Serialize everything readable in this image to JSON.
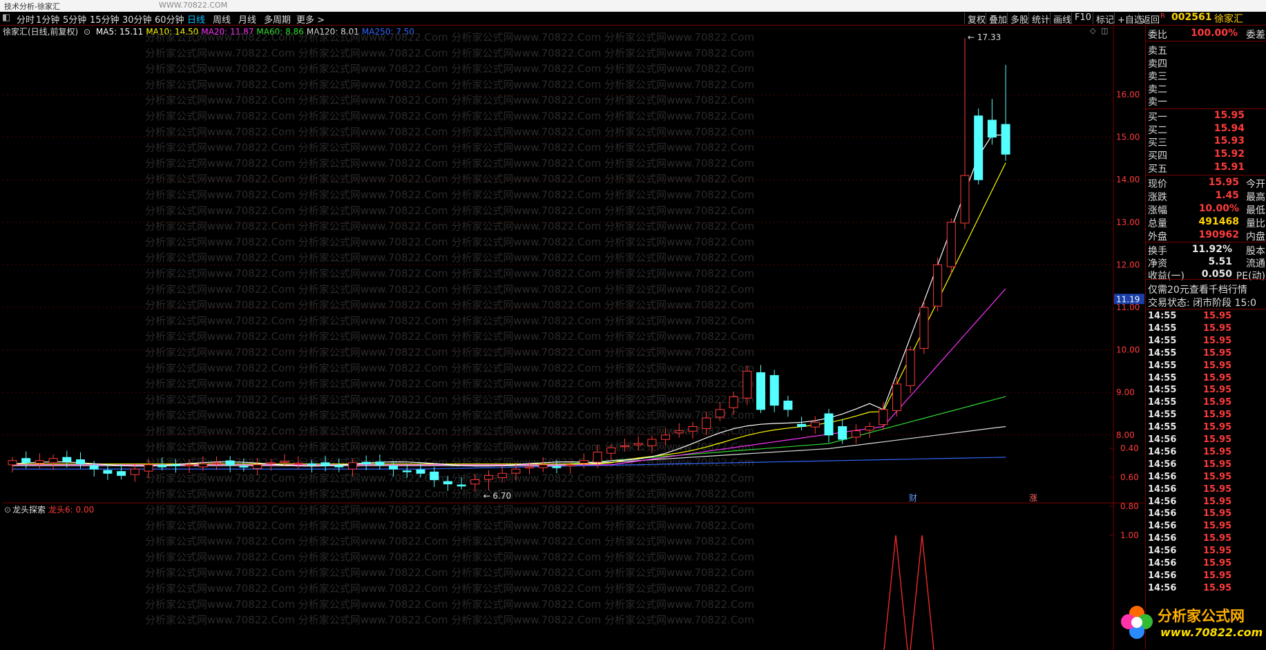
{
  "topbar": {
    "title": "技术分析-徐家汇",
    "window_text": "WWW.70822.COM"
  },
  "toolbar": {
    "periods": [
      "分时",
      "1分钟",
      "5分钟",
      "15分钟",
      "30分钟",
      "60分钟",
      "日线",
      "周线",
      "月线",
      "多周期",
      "更多 >"
    ],
    "active_period": "日线",
    "right_tools": [
      "复权",
      "叠加",
      "多股",
      "统计",
      "画线",
      "F10",
      "标记",
      "+自选",
      "返回"
    ]
  },
  "stock": {
    "code": "002561",
    "name": "徐家汇",
    "r_mark": "R"
  },
  "legend": {
    "title": "徐家汇(日线,前复权)",
    "mas": [
      {
        "label": "MA5: 15.11",
        "color": "#ffffff"
      },
      {
        "label": "MA10: 14.50",
        "color": "#ffff00"
      },
      {
        "label": "MA20: 11.87",
        "color": "#ff33ff"
      },
      {
        "label": "MA60: 8.86",
        "color": "#33dd33"
      },
      {
        "label": "MA120: 8.01",
        "color": "#dddddd"
      },
      {
        "label": "MA250: 7.50",
        "color": "#3366ff"
      }
    ]
  },
  "price_axis": {
    "labels": [
      "16.00",
      "15.00",
      "14.00",
      "13.00",
      "12.00",
      "11.00",
      "10.00",
      "9.00",
      "8.00"
    ],
    "current_tag": "11.19",
    "high_label": "17.33",
    "low_label": "6.70",
    "markers": [
      "财",
      "涨"
    ]
  },
  "indicator": {
    "name": "龙头探索",
    "value_label": "龙头6: 0.00",
    "axis": [
      "1.00",
      "0.80",
      "0.60",
      "0.40"
    ]
  },
  "watermark": "分析家公式网www.70822.Com",
  "quote_panel": {
    "weibi": {
      "label": "委比",
      "value": "100.00%",
      "label2": "委差"
    },
    "sell": [
      {
        "label": "卖五",
        "price": ""
      },
      {
        "label": "卖四",
        "price": ""
      },
      {
        "label": "卖三",
        "price": ""
      },
      {
        "label": "卖二",
        "price": ""
      },
      {
        "label": "卖一",
        "price": ""
      }
    ],
    "buy": [
      {
        "label": "买一",
        "price": "15.95"
      },
      {
        "label": "买二",
        "price": "15.94"
      },
      {
        "label": "买三",
        "price": "15.93"
      },
      {
        "label": "买四",
        "price": "15.92"
      },
      {
        "label": "买五",
        "price": "15.91"
      }
    ],
    "stats": [
      {
        "label": "现价",
        "value": "15.95",
        "label2": "今开",
        "color": "#ff3b3b"
      },
      {
        "label": "涨跌",
        "value": "1.45",
        "label2": "最高",
        "color": "#ff3b3b"
      },
      {
        "label": "涨幅",
        "value": "10.00%",
        "label2": "最低",
        "color": "#ff3b3b"
      },
      {
        "label": "总量",
        "value": "491468",
        "label2": "量比",
        "color": "#ffd400"
      },
      {
        "label": "外盘",
        "value": "190962",
        "label2": "内盘",
        "color": "#ff3b3b"
      }
    ],
    "stats2": [
      {
        "label": "换手",
        "value": "11.92%",
        "label2": "股本",
        "color": "#e8e8e8"
      },
      {
        "label": "净资",
        "value": "5.51",
        "label2": "流通",
        "color": "#e8e8e8"
      },
      {
        "label": "收益(一)",
        "value": "0.050",
        "label2": "PE(动)",
        "color": "#e8e8e8"
      }
    ],
    "promo": "仅需20元查看千档行情",
    "trade_status": "交易状态: 闭市阶段 15:0"
  },
  "ticks": [
    {
      "time": "14:55",
      "price": "15.95"
    },
    {
      "time": "14:55",
      "price": "15.95"
    },
    {
      "time": "14:55",
      "price": "15.95"
    },
    {
      "time": "14:55",
      "price": "15.95"
    },
    {
      "time": "14:55",
      "price": "15.95"
    },
    {
      "time": "14:55",
      "price": "15.95"
    },
    {
      "time": "14:55",
      "price": "15.95"
    },
    {
      "time": "14:55",
      "price": "15.95"
    },
    {
      "time": "14:55",
      "price": "15.95"
    },
    {
      "time": "14:55",
      "price": "15.95"
    },
    {
      "time": "14:56",
      "price": "15.95"
    },
    {
      "time": "14:56",
      "price": "15.95"
    },
    {
      "time": "14:56",
      "price": "15.95"
    },
    {
      "time": "14:56",
      "price": "15.95"
    },
    {
      "time": "14:56",
      "price": "15.95"
    },
    {
      "time": "14:56",
      "price": "15.95"
    },
    {
      "time": "14:56",
      "price": "15.95"
    },
    {
      "time": "14:56",
      "price": "15.95"
    },
    {
      "time": "14:56",
      "price": "15.95"
    },
    {
      "time": "14:56",
      "price": "15.95"
    },
    {
      "time": "14:56",
      "price": "15.95"
    },
    {
      "time": "14:56",
      "price": "15.95"
    },
    {
      "time": "14:56",
      "price": "15.95"
    }
  ],
  "logo": {
    "line1": "分析家公式网",
    "line2": "www.70822.com"
  }
}
